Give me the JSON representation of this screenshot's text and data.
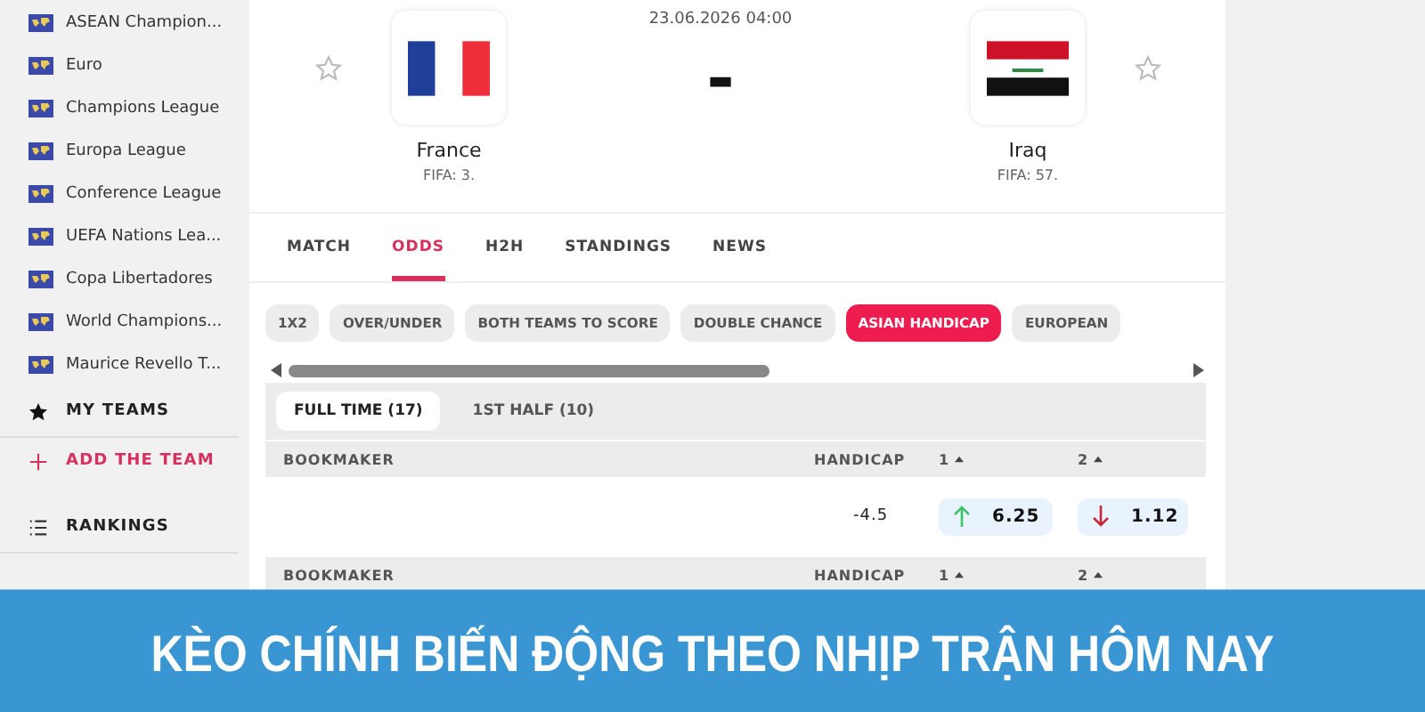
{
  "sidebar": {
    "competitions": [
      {
        "label": "ASEAN Champion..."
      },
      {
        "label": "Euro"
      },
      {
        "label": "Champions League"
      },
      {
        "label": "Europa League"
      },
      {
        "label": "Conference League"
      },
      {
        "label": "UEFA Nations Lea..."
      },
      {
        "label": "Copa Libertadores"
      },
      {
        "label": "World Champions..."
      },
      {
        "label": "Maurice Revello T..."
      }
    ],
    "sections": [
      {
        "kind": "heading",
        "label": "MY TEAMS"
      },
      {
        "kind": "action",
        "label": "ADD THE TEAM"
      },
      {
        "kind": "heading",
        "label": "RANKINGS"
      }
    ]
  },
  "match": {
    "datetime": "23.06.2026 04:00",
    "score": "-",
    "home": {
      "name": "France",
      "rank": "FIFA: 3."
    },
    "away": {
      "name": "Iraq",
      "rank": "FIFA: 57."
    }
  },
  "tabs": [
    {
      "label": "MATCH",
      "selected": false
    },
    {
      "label": "ODDS",
      "selected": true
    },
    {
      "label": "H2H",
      "selected": false
    },
    {
      "label": "STANDINGS",
      "selected": false
    },
    {
      "label": "NEWS",
      "selected": false
    }
  ],
  "markets": [
    {
      "label": "1X2",
      "selected": false
    },
    {
      "label": "OVER/UNDER",
      "selected": false
    },
    {
      "label": "BOTH TEAMS TO SCORE",
      "selected": false
    },
    {
      "label": "DOUBLE CHANCE",
      "selected": false
    },
    {
      "label": "ASIAN HANDICAP",
      "selected": true
    },
    {
      "label": "EUROPEAN",
      "selected": false
    }
  ],
  "periods": [
    {
      "label": "FULL TIME (17)",
      "selected": true
    },
    {
      "label": "1ST HALF (10)",
      "selected": false
    }
  ],
  "tables": [
    {
      "columns": [
        "BOOKMAKER",
        "HANDICAP",
        "1",
        "2"
      ],
      "rows": [
        {
          "handicap": "-4.5",
          "odds": [
            {
              "value": "6.25",
              "kind": "up"
            },
            {
              "value": "1.12",
              "kind": "down"
            }
          ]
        }
      ]
    },
    {
      "columns": [
        "BOOKMAKER",
        "HANDICAP",
        "1",
        "2"
      ]
    }
  ],
  "banner": "KÈO CHÍNH BIẾN ĐỘNG THEO NHỊP TRẬN HÔM NAY"
}
